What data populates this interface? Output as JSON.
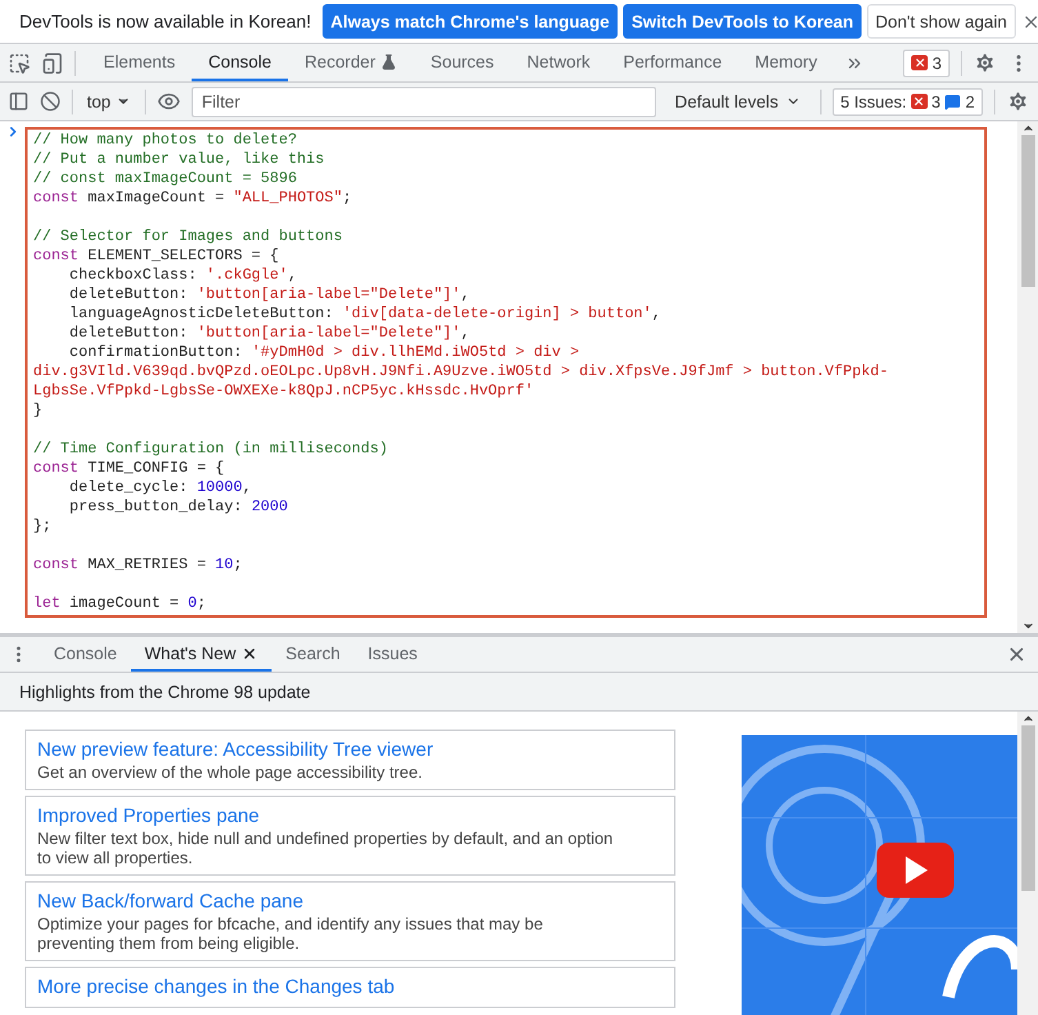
{
  "infobar": {
    "message": "DevTools is now available in Korean!",
    "buttons": [
      {
        "label": "Always match Chrome's language",
        "kind": "primary"
      },
      {
        "label": "Switch DevTools to Korean",
        "kind": "primary"
      },
      {
        "label": "Don't show again",
        "kind": "secondary"
      }
    ]
  },
  "main_tabs": [
    {
      "label": "Elements",
      "selected": false,
      "kind": "plain"
    },
    {
      "label": "Console",
      "selected": true,
      "kind": "plain"
    },
    {
      "label": "Recorder",
      "selected": false,
      "kind": "experiment"
    },
    {
      "label": "Sources",
      "selected": false,
      "kind": "plain"
    },
    {
      "label": "Network",
      "selected": false,
      "kind": "plain"
    },
    {
      "label": "Performance",
      "selected": false,
      "kind": "plain"
    },
    {
      "label": "Memory",
      "selected": false,
      "kind": "plain"
    }
  ],
  "error_count": "3",
  "console_toolbar": {
    "context": "top",
    "filter_placeholder": "Filter",
    "levels": "Default levels",
    "issues": {
      "label": "5 Issues:",
      "errors": "3",
      "messages": "2"
    }
  },
  "code_lines": [
    {
      "kind": "code",
      "tokens": [
        {
          "kind": "comment",
          "text": "// How many photos to delete?"
        }
      ]
    },
    {
      "kind": "code",
      "tokens": [
        {
          "kind": "comment",
          "text": "// Put a number value, like this"
        }
      ]
    },
    {
      "kind": "code",
      "tokens": [
        {
          "kind": "comment",
          "text": "// const maxImageCount = 5896"
        }
      ]
    },
    {
      "kind": "code",
      "tokens": [
        {
          "kind": "keyword",
          "text": "const"
        },
        {
          "kind": "plain",
          "text": " maxImageCount = "
        },
        {
          "kind": "string",
          "text": "\"ALL_PHOTOS\""
        },
        {
          "kind": "plain",
          "text": ";"
        }
      ]
    },
    {
      "kind": "blank"
    },
    {
      "kind": "code",
      "tokens": [
        {
          "kind": "comment",
          "text": "// Selector for Images and buttons"
        }
      ]
    },
    {
      "kind": "code",
      "tokens": [
        {
          "kind": "keyword",
          "text": "const"
        },
        {
          "kind": "plain",
          "text": " ELEMENT_SELECTORS = {"
        }
      ]
    },
    {
      "kind": "code",
      "tokens": [
        {
          "kind": "plain",
          "text": "    checkboxClass: "
        },
        {
          "kind": "string",
          "text": "'.ckGgle'"
        },
        {
          "kind": "plain",
          "text": ","
        }
      ]
    },
    {
      "kind": "code",
      "tokens": [
        {
          "kind": "plain",
          "text": "    deleteButton: "
        },
        {
          "kind": "string",
          "text": "'button[aria-label=\"Delete\"]'"
        },
        {
          "kind": "plain",
          "text": ","
        }
      ]
    },
    {
      "kind": "code",
      "tokens": [
        {
          "kind": "plain",
          "text": "    languageAgnosticDeleteButton: "
        },
        {
          "kind": "string",
          "text": "'div[data-delete-origin] > button'"
        },
        {
          "kind": "plain",
          "text": ","
        }
      ]
    },
    {
      "kind": "code",
      "tokens": [
        {
          "kind": "plain",
          "text": "    deleteButton: "
        },
        {
          "kind": "string",
          "text": "'button[aria-label=\"Delete\"]'"
        },
        {
          "kind": "plain",
          "text": ","
        }
      ]
    },
    {
      "kind": "code",
      "tokens": [
        {
          "kind": "plain",
          "text": "    confirmationButton: "
        },
        {
          "kind": "string",
          "text": "'#yDmH0d > div.llhEMd.iWO5td > div >"
        }
      ]
    },
    {
      "kind": "code",
      "tokens": [
        {
          "kind": "string",
          "text": "div.g3VIld.V639qd.bvQPzd.oEOLpc.Up8vH.J9Nfi.A9Uzve.iWO5td > div.XfpsVe.J9fJmf > button.VfPpkd-"
        }
      ]
    },
    {
      "kind": "code",
      "tokens": [
        {
          "kind": "string",
          "text": "LgbsSe.VfPpkd-LgbsSe-OWXEXe-k8QpJ.nCP5yc.kHssdc.HvOprf'"
        }
      ]
    },
    {
      "kind": "code",
      "tokens": [
        {
          "kind": "plain",
          "text": "}"
        }
      ]
    },
    {
      "kind": "blank"
    },
    {
      "kind": "code",
      "tokens": [
        {
          "kind": "comment",
          "text": "// Time Configuration (in milliseconds)"
        }
      ]
    },
    {
      "kind": "code",
      "tokens": [
        {
          "kind": "keyword",
          "text": "const"
        },
        {
          "kind": "plain",
          "text": " TIME_CONFIG = {"
        }
      ]
    },
    {
      "kind": "code",
      "tokens": [
        {
          "kind": "plain",
          "text": "    delete_cycle: "
        },
        {
          "kind": "number",
          "text": "10000"
        },
        {
          "kind": "plain",
          "text": ","
        }
      ]
    },
    {
      "kind": "code",
      "tokens": [
        {
          "kind": "plain",
          "text": "    press_button_delay: "
        },
        {
          "kind": "number",
          "text": "2000"
        }
      ]
    },
    {
      "kind": "code",
      "tokens": [
        {
          "kind": "plain",
          "text": "};"
        }
      ]
    },
    {
      "kind": "blank"
    },
    {
      "kind": "code",
      "tokens": [
        {
          "kind": "keyword",
          "text": "const"
        },
        {
          "kind": "plain",
          "text": " MAX_RETRIES = "
        },
        {
          "kind": "number",
          "text": "10"
        },
        {
          "kind": "plain",
          "text": ";"
        }
      ]
    },
    {
      "kind": "blank"
    },
    {
      "kind": "code",
      "tokens": [
        {
          "kind": "keyword",
          "text": "let"
        },
        {
          "kind": "plain",
          "text": " imageCount = "
        },
        {
          "kind": "number",
          "text": "0"
        },
        {
          "kind": "plain",
          "text": ";"
        }
      ]
    }
  ],
  "drawer": {
    "tabs": [
      {
        "label": "Console",
        "selected": false,
        "closable": false
      },
      {
        "label": "What's New",
        "selected": true,
        "closable": true
      },
      {
        "label": "Search",
        "selected": false,
        "closable": false
      },
      {
        "label": "Issues",
        "selected": false,
        "closable": false
      }
    ],
    "header": "Highlights from the Chrome 98 update",
    "cards": [
      {
        "title": "New preview feature: Accessibility Tree viewer",
        "description": "Get an overview of the whole page accessibility tree."
      },
      {
        "title": "Improved Properties pane",
        "description": "New filter text box, hide null and undefined properties by default, and an option to view all properties."
      },
      {
        "title": "New Back/forward Cache pane",
        "description": "Optimize your pages for bfcache, and identify any issues that may be preventing them from being eligible."
      },
      {
        "title": "More precise changes in the Changes tab"
      }
    ]
  }
}
